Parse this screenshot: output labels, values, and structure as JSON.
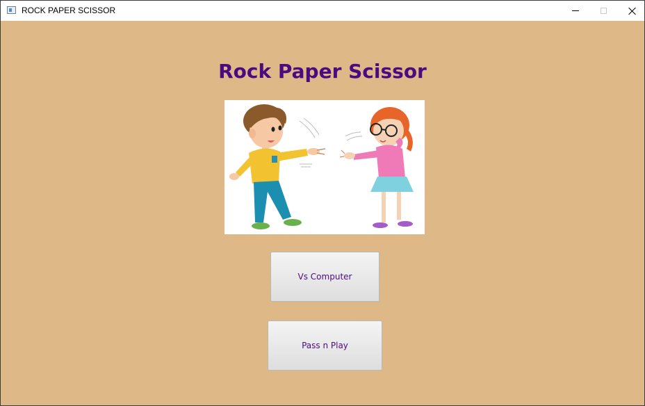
{
  "window": {
    "title": "ROCK PAPER SCISSOR"
  },
  "main": {
    "heading": "Rock Paper Scissor",
    "buttons": {
      "vs_computer": "Vs Computer",
      "pass_n_play": "Pass n Play"
    }
  },
  "colors": {
    "background": "#deb887",
    "heading": "#4b0b80",
    "button_text": "#4b0b80"
  },
  "icons": {
    "app": "app-window-icon",
    "minimize": "minimize-icon",
    "maximize": "maximize-icon",
    "close": "close-icon"
  },
  "illustration": "boy-and-girl-playing-rock-paper-scissors"
}
